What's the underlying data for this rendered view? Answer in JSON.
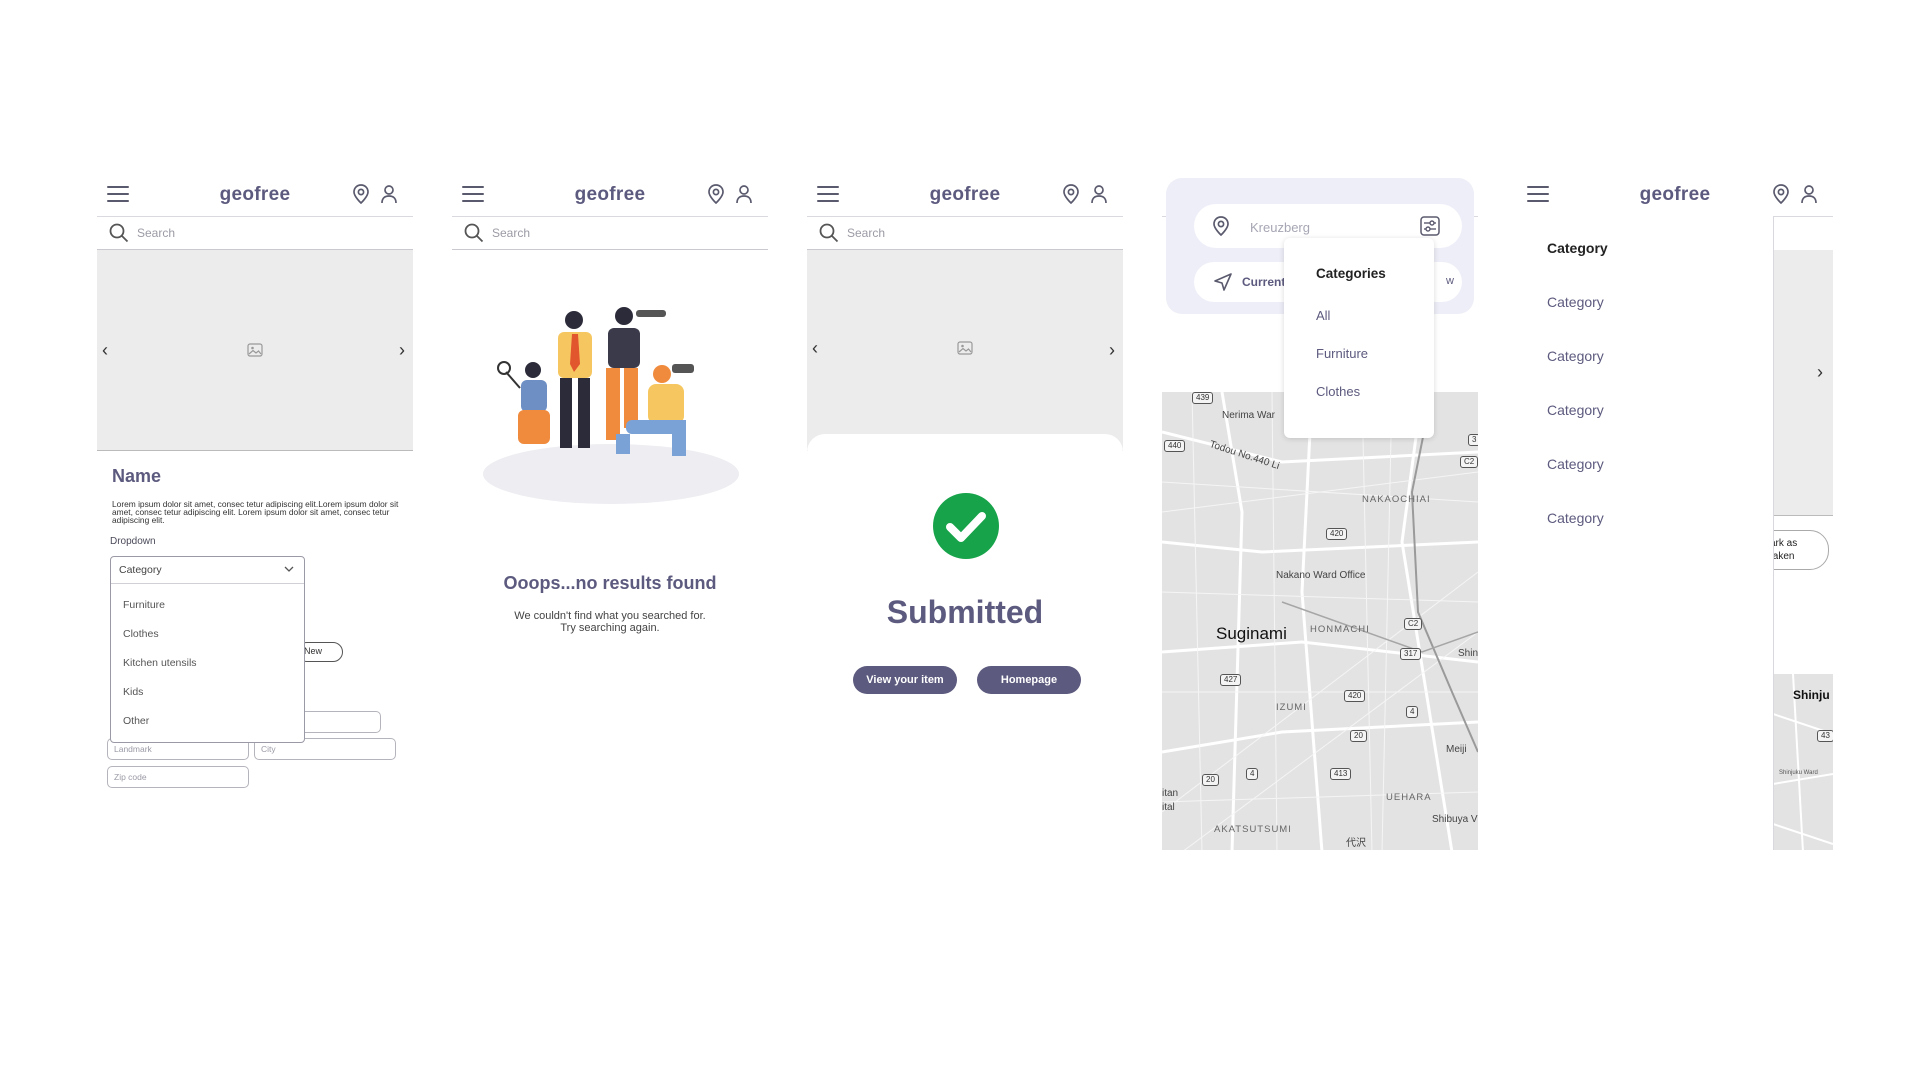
{
  "brand": "geofree",
  "search_placeholder": "Search",
  "icons": {
    "menu": "hamburger-icon",
    "location": "map-pin-icon",
    "profile": "user-icon",
    "search": "search-icon",
    "image_placeholder": "image-icon",
    "success": "check-circle-icon",
    "filter": "filter-icon",
    "navigate": "navigation-arrow-icon"
  },
  "colors": {
    "accent": "#5c5a7e",
    "success": "#17a34a"
  },
  "screen1": {
    "name_title": "Name",
    "lorem": "Lorem ipsum dolor sit amet, consec tetur adipiscing elit.Lorem ipsum dolor sit amet, consec tetur adipiscing elit. Lorem ipsum dolor sit amet, consec tetur adipiscing elit.",
    "dropdown_label": "Dropdown",
    "dropdown_selected": "Category",
    "dropdown_options": [
      "Furniture",
      "Clothes",
      "Kitchen utensils",
      "Kids",
      "Other"
    ],
    "new_pill": "New",
    "fields": {
      "landmark": "Landmark",
      "city": "City",
      "zip": "Zip code"
    }
  },
  "screen2": {
    "title": "Ooops...no results found",
    "subtitle_line1": "We couldn't find what you searched for.",
    "subtitle_line2": "Try searching again."
  },
  "screen3": {
    "title": "Submitted",
    "view_item_button": "View your item",
    "homepage_button": "Homepage"
  },
  "screen4": {
    "location_value": "Kreuzberg",
    "current_button": "Current",
    "hidden_button_fragment": "w",
    "categories_title": "Categories",
    "categories": [
      "All",
      "Furniture",
      "Clothes"
    ],
    "map_labels": {
      "suginami": "Suginami",
      "nerima": "Nerima War",
      "todou": "Todou No.440 Li",
      "nakaochiai": "NAKAOCHIAI",
      "nakano_office": "Nakano Ward Office",
      "honmachi": "HONMACHI",
      "izumi": "IZUMI",
      "uehara": "UEHARA",
      "akatsutsumi": "AKATSUTSUMI",
      "shibuya": "Shibuya V",
      "meiji": "Meiji",
      "shin": "Shin",
      "itan": "itan",
      "ital": "ital",
      "daizawa": "代沢"
    },
    "road_shields": [
      "439",
      "440",
      "420",
      "C2",
      "317",
      "427",
      "420",
      "4",
      "20",
      "20",
      "4",
      "413",
      "3",
      "C2"
    ]
  },
  "screen5": {
    "menu_items": [
      "Category",
      "Category",
      "Category",
      "Category",
      "Category",
      "Category"
    ],
    "mark_pill_line1": "ark as",
    "mark_pill_line2": "taken",
    "map_label": "Shinju",
    "map_label_small": "Shinjuku Ward",
    "road_shield": "43"
  }
}
